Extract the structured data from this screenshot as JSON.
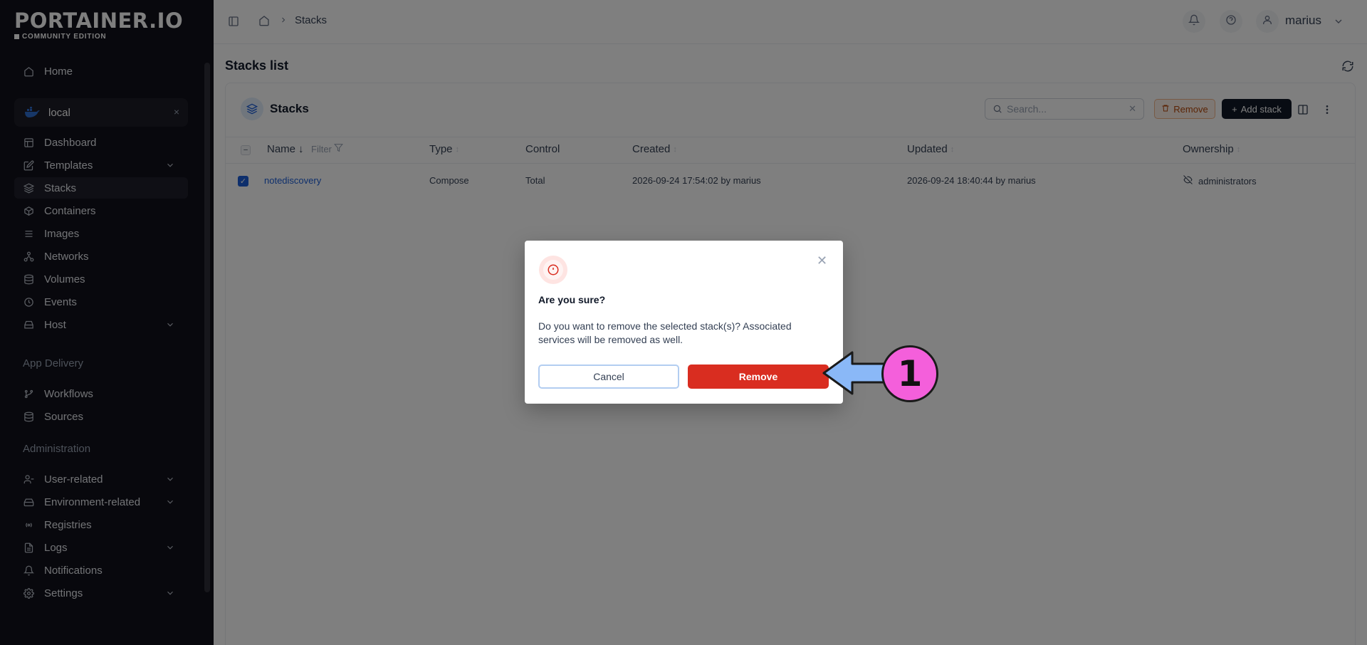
{
  "brand": {
    "logo": "PORTAINER.IO",
    "edition": "COMMUNITY EDITION"
  },
  "sidebar": {
    "home": "Home",
    "environment": {
      "name": "local",
      "close": "×"
    },
    "env_items": [
      {
        "label": "Dashboard",
        "icon": "dashboard-icon"
      },
      {
        "label": "Templates",
        "icon": "templates-icon",
        "expandable": true
      },
      {
        "label": "Stacks",
        "icon": "stacks-icon",
        "active": true
      },
      {
        "label": "Containers",
        "icon": "containers-icon"
      },
      {
        "label": "Images",
        "icon": "images-icon"
      },
      {
        "label": "Networks",
        "icon": "networks-icon"
      },
      {
        "label": "Volumes",
        "icon": "volumes-icon"
      },
      {
        "label": "Events",
        "icon": "events-icon"
      },
      {
        "label": "Host",
        "icon": "host-icon",
        "expandable": true
      }
    ],
    "app_delivery": {
      "title": "App Delivery",
      "items": [
        {
          "label": "Workflows",
          "icon": "workflows-icon"
        },
        {
          "label": "Sources",
          "icon": "sources-icon"
        }
      ]
    },
    "administration": {
      "title": "Administration",
      "items": [
        {
          "label": "User-related",
          "icon": "users-icon",
          "expandable": true
        },
        {
          "label": "Environment-related",
          "icon": "environment-icon",
          "expandable": true
        },
        {
          "label": "Registries",
          "icon": "registries-icon"
        },
        {
          "label": "Logs",
          "icon": "logs-icon",
          "expandable": true
        },
        {
          "label": "Notifications",
          "icon": "bell-icon"
        },
        {
          "label": "Settings",
          "icon": "gear-icon",
          "expandable": true
        }
      ]
    }
  },
  "header": {
    "breadcrumb": {
      "current": "Stacks"
    },
    "user": "marius"
  },
  "main": {
    "page_title": "Stacks list",
    "card_title": "Stacks",
    "search_placeholder": "Search...",
    "remove_label": "Remove",
    "add_label": "Add stack",
    "columns": {
      "name": "Name",
      "filter": "Filter",
      "type": "Type",
      "control": "Control",
      "created": "Created",
      "updated": "Updated",
      "ownership": "Ownership"
    },
    "rows": [
      {
        "name": "notediscovery",
        "type": "Compose",
        "control": "Total",
        "created": "2026-09-24 17:54:02 by marius",
        "updated": "2026-09-24 18:40:44 by marius",
        "ownership": "administrators",
        "selected": true
      }
    ]
  },
  "modal": {
    "title": "Are you sure?",
    "body": "Do you want to remove the selected stack(s)? Associated services will be removed as well.",
    "cancel": "Cancel",
    "confirm": "Remove"
  },
  "annotation": {
    "step": "1"
  },
  "colors": {
    "sidebar_bg": "#11111a",
    "accent": "#1d5ed8",
    "danger": "#d92d20",
    "annotation_circle": "#f45fdb",
    "annotation_arrow": "#8ab8f7"
  }
}
